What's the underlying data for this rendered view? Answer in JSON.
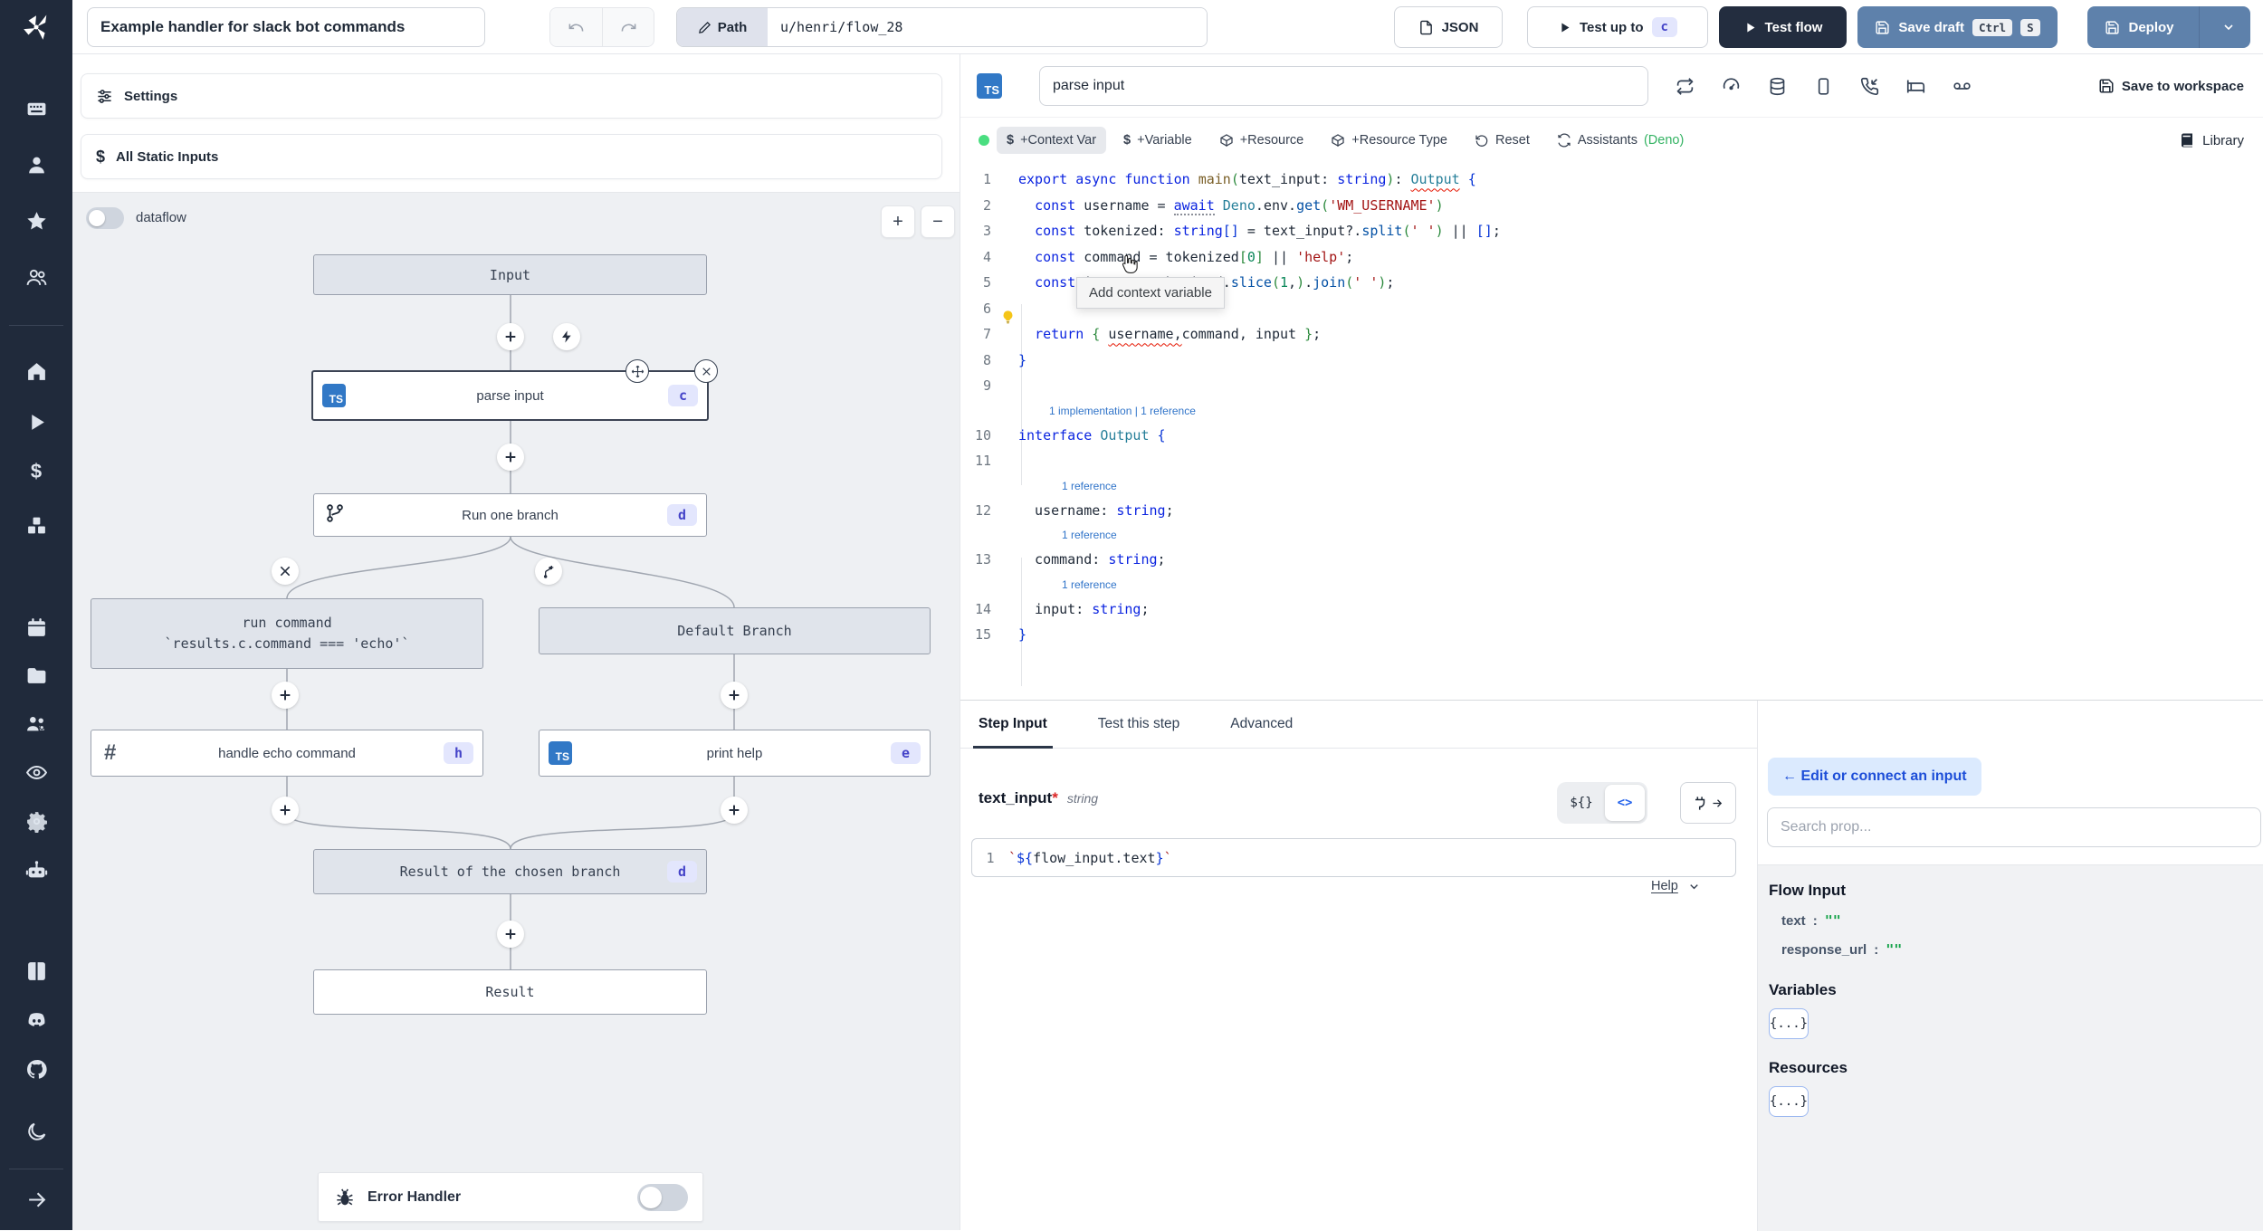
{
  "topbar": {
    "title_value": "Example handler for slack bot commands",
    "path_label": "Path",
    "path_value": "u/henri/flow_28",
    "json_label": "JSON",
    "test_up_to_label": "Test up to",
    "test_up_to_step": "c",
    "test_flow_label": "Test flow",
    "save_draft_label": "Save draft",
    "save_draft_kbd1": "Ctrl",
    "save_draft_kbd2": "S",
    "deploy_label": "Deploy"
  },
  "sidebar": {
    "icons": [
      "keyboard",
      "user",
      "star",
      "users",
      "home",
      "play",
      "dollar",
      "boxes",
      "calendar",
      "folder",
      "user-group",
      "eye",
      "gear",
      "bot",
      "book",
      "discord",
      "github",
      "moon",
      "arrow-right"
    ]
  },
  "flow": {
    "settings_label": "Settings",
    "static_inputs_label": "All Static Inputs",
    "static_inputs_icon": "$",
    "dataflow_label": "dataflow",
    "zoom_in": "+",
    "zoom_out": "−",
    "nodes": {
      "input": {
        "label": "Input"
      },
      "parse": {
        "lang": "TS",
        "label": "parse input",
        "badge": "c"
      },
      "run_one_branch": {
        "label": "Run one branch",
        "badge": "d"
      },
      "run_command": {
        "label": "run command",
        "sublabel": "`results.c.command === 'echo'`"
      },
      "default_branch": {
        "label": "Default Branch"
      },
      "handle_echo": {
        "icon": "#",
        "label": "handle echo command",
        "badge": "h"
      },
      "print_help": {
        "lang": "TS",
        "label": "print help",
        "badge": "e"
      },
      "chosen_result": {
        "label": "Result of the chosen branch",
        "badge": "d"
      },
      "result": {
        "label": "Result"
      }
    },
    "error_handler_label": "Error Handler"
  },
  "step": {
    "lang_badge": "TS",
    "name_value": "parse input",
    "save_to_workspace_label": "Save to workspace",
    "toolbar": {
      "context_var_icon": "$",
      "context_var": "+Context Var",
      "variable_icon": "$",
      "variable": "+Variable",
      "resource": "+Resource",
      "resource_type": "+Resource Type",
      "reset": "Reset",
      "assistants": "Assistants",
      "assistants_lang": "(Deno)",
      "library": "Library"
    },
    "tooltip": "Add context variable",
    "code": {
      "rows": [
        {
          "n": "1",
          "segs": [
            [
              "k",
              "export"
            ],
            [
              "d",
              " "
            ],
            [
              "k",
              "async"
            ],
            [
              "d",
              " "
            ],
            [
              "k",
              "function"
            ],
            [
              "d",
              " "
            ],
            [
              "f",
              "main"
            ],
            [
              "bG",
              "("
            ],
            [
              "d",
              "text_input"
            ],
            [
              "d",
              ": "
            ],
            [
              "k",
              "string"
            ],
            [
              "bG",
              ")"
            ],
            [
              "d",
              ": "
            ],
            [
              "t sq",
              "Output"
            ],
            [
              "d",
              " "
            ],
            [
              "bB",
              "{"
            ]
          ]
        },
        {
          "n": "2",
          "bulb": true,
          "segs": [
            [
              "d",
              "  "
            ],
            [
              "k",
              "const"
            ],
            [
              "d",
              " username = "
            ],
            [
              "k dots",
              "await"
            ],
            [
              "d",
              " "
            ],
            [
              "t",
              "Deno"
            ],
            [
              "d",
              ".env."
            ],
            [
              "m",
              "get"
            ],
            [
              "bG",
              "("
            ],
            [
              "s",
              "'WM_USERNAME'"
            ],
            [
              "bG",
              ")"
            ]
          ]
        },
        {
          "n": "3",
          "segs": [
            [
              "d",
              "  "
            ],
            [
              "k",
              "const"
            ],
            [
              "d",
              " tokenized: "
            ],
            [
              "k",
              "string"
            ],
            [
              "bB",
              "[]"
            ],
            [
              "d",
              " = text_input?."
            ],
            [
              "m",
              "split"
            ],
            [
              "bG",
              "("
            ],
            [
              "s",
              "' '"
            ],
            [
              "bG",
              ")"
            ],
            [
              "d",
              " || "
            ],
            [
              "bB",
              "[]"
            ],
            [
              "d",
              ";"
            ]
          ]
        },
        {
          "n": "4",
          "segs": [
            [
              "d",
              "  "
            ],
            [
              "k",
              "const"
            ],
            [
              "d",
              " command = tokenized"
            ],
            [
              "bG",
              "["
            ],
            [
              "n1",
              "0"
            ],
            [
              "bG",
              "]"
            ],
            [
              "d",
              " || "
            ],
            [
              "s",
              "'help'"
            ],
            [
              "d",
              ";"
            ]
          ]
        },
        {
          "n": "5",
          "segs": [
            [
              "d",
              "  "
            ],
            [
              "k",
              "const"
            ],
            [
              "d",
              " input = tokenized."
            ],
            [
              "m",
              "slice"
            ],
            [
              "bG",
              "("
            ],
            [
              "n1",
              "1"
            ],
            [
              "d",
              ","
            ],
            [
              "bG",
              ")"
            ],
            [
              "d",
              "."
            ],
            [
              "m",
              "join"
            ],
            [
              "bG",
              "("
            ],
            [
              "s",
              "' '"
            ],
            [
              "bG",
              ")"
            ],
            [
              "d",
              ";"
            ]
          ]
        },
        {
          "n": "6",
          "segs": []
        },
        {
          "n": "7",
          "segs": [
            [
              "d",
              "  "
            ],
            [
              "k",
              "return"
            ],
            [
              "d",
              " "
            ],
            [
              "bG",
              "{"
            ],
            [
              "d",
              " "
            ],
            [
              "d sq",
              "username,"
            ],
            [
              "d",
              "command, input "
            ],
            [
              "bG",
              "}"
            ],
            [
              "d",
              ";"
            ]
          ]
        },
        {
          "n": "8",
          "segs": [
            [
              "bB",
              "}"
            ]
          ]
        },
        {
          "n": "9",
          "segs": []
        },
        {
          "lens": "1 implementation | 1 reference"
        },
        {
          "n": "10",
          "segs": [
            [
              "k",
              "interface"
            ],
            [
              "d",
              " "
            ],
            [
              "t",
              "Output"
            ],
            [
              "d",
              " "
            ],
            [
              "bB",
              "{"
            ]
          ]
        },
        {
          "n": "11",
          "segs": []
        },
        {
          "lens": "1 reference",
          "indent": true
        },
        {
          "n": "12",
          "segs": [
            [
              "d",
              "  username: "
            ],
            [
              "k",
              "string"
            ],
            [
              "d",
              ";"
            ]
          ]
        },
        {
          "lens": "1 reference",
          "indent": true
        },
        {
          "n": "13",
          "segs": [
            [
              "d",
              "  command: "
            ],
            [
              "k",
              "string"
            ],
            [
              "d",
              ";"
            ]
          ]
        },
        {
          "lens": "1 reference",
          "indent": true
        },
        {
          "n": "14",
          "segs": [
            [
              "d",
              "  input: "
            ],
            [
              "k",
              "string"
            ],
            [
              "d",
              ";"
            ]
          ]
        },
        {
          "n": "15",
          "segs": [
            [
              "bB",
              "}"
            ]
          ]
        }
      ]
    }
  },
  "bottom": {
    "tabs": [
      {
        "label": "Step Input"
      },
      {
        "label": "Test this step"
      },
      {
        "label": "Advanced"
      }
    ],
    "field_name": "text_input",
    "field_required": "*",
    "field_type": "string",
    "toggle_expr": "${}",
    "toggle_code": "<>",
    "editor_line_number": "1",
    "editor_segments": [
      [
        "s",
        "`"
      ],
      [
        "bB",
        "${"
      ],
      [
        "d",
        "flow_input.text"
      ],
      [
        "bB",
        "}"
      ],
      [
        "s",
        "`"
      ]
    ],
    "help_label": "Help"
  },
  "props": {
    "edit_connect_label": "← Edit or connect an input",
    "search_placeholder": "Search prop...",
    "flow_input_title": "Flow Input",
    "fields": [
      {
        "name": "text",
        "value": "\"\""
      },
      {
        "name": "response_url",
        "value": "\"\""
      }
    ],
    "variables_title": "Variables",
    "resources_title": "Resources",
    "object_token": "{...}"
  },
  "colors": {
    "sidebar_bg": "#202a3b",
    "steel_button": "#5e81ab",
    "dark_button": "#232d3f",
    "badge_bg": "#e3e6fd",
    "badge_text": "#4443c8",
    "ts_blue": "#3178c6",
    "canvas_bg": "#eef0f3",
    "green_value": "#16a34a",
    "edit_connect_bg": "#dbeafe",
    "edit_connect_text": "#1d4ed8"
  }
}
